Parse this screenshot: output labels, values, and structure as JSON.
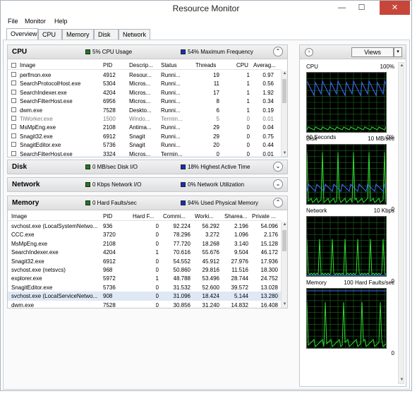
{
  "window": {
    "title": "Resource Monitor",
    "minimize": "—",
    "maximize": "☐",
    "close": "✕"
  },
  "menu": [
    "File",
    "Monitor",
    "Help"
  ],
  "tabs": [
    "Overview",
    "CPU",
    "Memory",
    "Disk",
    "Network"
  ],
  "colors": {
    "accent_green": "#1a7f1a",
    "accent_blue": "#1030c8",
    "graph_bg": "#000000",
    "graph_grid": "#1b6e1b",
    "graph_green": "#2ddc2d",
    "graph_blue": "#3b6fff"
  },
  "cpu_panel": {
    "title": "CPU",
    "usage": "5% CPU Usage",
    "freq": "54% Maximum Frequency",
    "columns": [
      "Image",
      "PID",
      "Descrip...",
      "Status",
      "Threads",
      "CPU",
      "Averag..."
    ],
    "rows": [
      [
        "perfmon.exe",
        "4912",
        "Resour...",
        "Runni...",
        "19",
        "1",
        "0.97"
      ],
      [
        "SearchProtocolHost.exe",
        "5304",
        "Micros...",
        "Runni...",
        "11",
        "1",
        "0.56"
      ],
      [
        "SearchIndexer.exe",
        "4204",
        "Micros...",
        "Runni...",
        "17",
        "1",
        "1.92"
      ],
      [
        "SearchFilterHost.exe",
        "6956",
        "Micros...",
        "Runni...",
        "8",
        "1",
        "0.34"
      ],
      [
        "dwm.exe",
        "7528",
        "Deskto...",
        "Runni...",
        "6",
        "1",
        "0.19"
      ],
      [
        "TiWorker.exe",
        "1500",
        "Windo...",
        "Termin...",
        "5",
        "0",
        "0.01"
      ],
      [
        "MsMpEng.exe",
        "2108",
        "Antima...",
        "Runni...",
        "29",
        "0",
        "0.04"
      ],
      [
        "Snagit32.exe",
        "6912",
        "Snagit",
        "Runni...",
        "29",
        "0",
        "0.75"
      ],
      [
        "SnagitEditor.exe",
        "5736",
        "Snagit",
        "Runni...",
        "20",
        "0",
        "0.44"
      ],
      [
        "SearchFilterHost.exe",
        "3324",
        "Micros...",
        "Termin...",
        "0",
        "0",
        "0.01"
      ]
    ]
  },
  "disk_panel": {
    "title": "Disk",
    "io": "0 MB/sec Disk I/O",
    "active": "18% Highest Active Time"
  },
  "network_panel": {
    "title": "Network",
    "io": "0 Kbps Network I/O",
    "util": "0% Network Utilization"
  },
  "memory_panel": {
    "title": "Memory",
    "faults": "0 Hard Faults/sec",
    "used": "94% Used Physical Memory",
    "columns": [
      "Image",
      "PID",
      "Hard F...",
      "Commi...",
      "Worki...",
      "Sharea...",
      "Private ..."
    ],
    "rows": [
      [
        "svchost.exe (LocalSystemNetwo...",
        "936",
        "0",
        "92.224",
        "56.292",
        "2.196",
        "54.096"
      ],
      [
        "CCC.exe",
        "3720",
        "0",
        "78.296",
        "3.272",
        "1.096",
        "2.176"
      ],
      [
        "MsMpEng.exe",
        "2108",
        "0",
        "77.720",
        "18.268",
        "3.140",
        "15.128"
      ],
      [
        "SearchIndexer.exe",
        "4204",
        "1",
        "70.616",
        "55.676",
        "9.504",
        "46.172"
      ],
      [
        "Snagit32.exe",
        "6912",
        "0",
        "54.552",
        "45.912",
        "27.976",
        "17.936"
      ],
      [
        "svchost.exe (netsvcs)",
        "968",
        "0",
        "50.860",
        "29.816",
        "11.516",
        "18.300"
      ],
      [
        "explorer.exe",
        "5972",
        "1",
        "48.788",
        "53.496",
        "28.744",
        "24.752"
      ],
      [
        "SnagitEditor.exe",
        "5736",
        "0",
        "31.532",
        "52.600",
        "39.572",
        "13.028"
      ],
      [
        "svchost.exe (LocalServiceNetwo...",
        "908",
        "0",
        "31.096",
        "18.424",
        "5.144",
        "13.280"
      ],
      [
        "dwm.exe",
        "7528",
        "0",
        "30.856",
        "31.240",
        "14.832",
        "16.408"
      ]
    ]
  },
  "right_panel": {
    "views_label": "Views",
    "views_arrow": "▾",
    "nav_arrow": "›",
    "graphs": [
      {
        "name": "CPU",
        "scale_top": "100%",
        "left_bottom": "60 Seconds",
        "scale_bottom": "0%"
      },
      {
        "name": "Disk",
        "scale_top": "10 MB/sec",
        "left_bottom": "",
        "scale_bottom": "0"
      },
      {
        "name": "Network",
        "scale_top": "10 Kbps",
        "left_bottom": "",
        "scale_bottom": "0"
      },
      {
        "name": "Memory",
        "scale_top": "100 Hard Faults/sec",
        "left_bottom": "",
        "scale_bottom": "0"
      }
    ]
  }
}
